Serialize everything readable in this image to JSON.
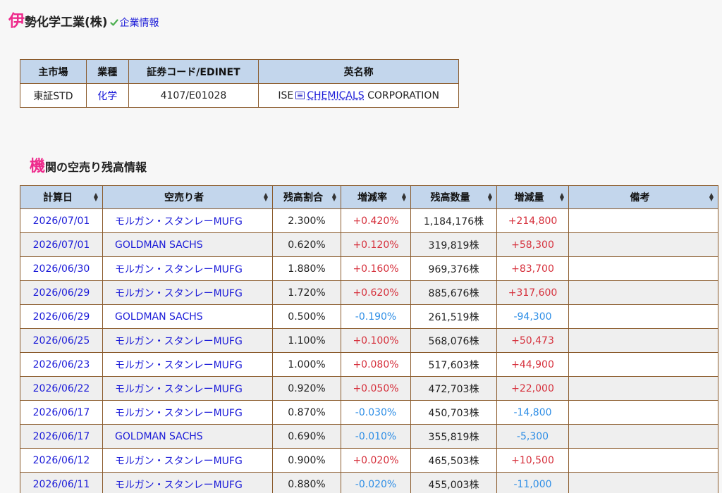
{
  "company": {
    "first_char": "伊",
    "rest": "勢化学工業(株)",
    "info_link": "企業情報"
  },
  "info_table": {
    "headers": [
      "主市場",
      "業種",
      "証券コード/EDINET",
      "英名称"
    ],
    "market": "東証STD",
    "industry": "化学",
    "code": "4107/E01028",
    "english_name_prefix": "ISE",
    "english_name_link": "CHEMICALS",
    "english_name_suffix": "CORPORATION"
  },
  "section": {
    "first_char": "機",
    "rest": "関の空売り残高情報"
  },
  "main_table": {
    "headers": [
      "計算日",
      "空売り者",
      "残高割合",
      "増減率",
      "残高数量",
      "増減量",
      "備考"
    ],
    "rows": [
      {
        "date": "2026/07/01",
        "seller": "モルガン・スタンレーMUFG",
        "ratio": "2.300%",
        "rate": "+0.420%",
        "qty": "1,184,176株",
        "change": "+214,800",
        "note": "",
        "sign": "pos"
      },
      {
        "date": "2026/07/01",
        "seller": "GOLDMAN SACHS",
        "ratio": "0.620%",
        "rate": "+0.120%",
        "qty": "319,819株",
        "change": "+58,300",
        "note": "",
        "sign": "pos"
      },
      {
        "date": "2026/06/30",
        "seller": "モルガン・スタンレーMUFG",
        "ratio": "1.880%",
        "rate": "+0.160%",
        "qty": "969,376株",
        "change": "+83,700",
        "note": "",
        "sign": "pos"
      },
      {
        "date": "2026/06/29",
        "seller": "モルガン・スタンレーMUFG",
        "ratio": "1.720%",
        "rate": "+0.620%",
        "qty": "885,676株",
        "change": "+317,600",
        "note": "",
        "sign": "pos"
      },
      {
        "date": "2026/06/29",
        "seller": "GOLDMAN SACHS",
        "ratio": "0.500%",
        "rate": "-0.190%",
        "qty": "261,519株",
        "change": "-94,300",
        "note": "",
        "sign": "neg"
      },
      {
        "date": "2026/06/25",
        "seller": "モルガン・スタンレーMUFG",
        "ratio": "1.100%",
        "rate": "+0.100%",
        "qty": "568,076株",
        "change": "+50,473",
        "note": "",
        "sign": "pos"
      },
      {
        "date": "2026/06/23",
        "seller": "モルガン・スタンレーMUFG",
        "ratio": "1.000%",
        "rate": "+0.080%",
        "qty": "517,603株",
        "change": "+44,900",
        "note": "",
        "sign": "pos"
      },
      {
        "date": "2026/06/22",
        "seller": "モルガン・スタンレーMUFG",
        "ratio": "0.920%",
        "rate": "+0.050%",
        "qty": "472,703株",
        "change": "+22,000",
        "note": "",
        "sign": "pos"
      },
      {
        "date": "2026/06/17",
        "seller": "モルガン・スタンレーMUFG",
        "ratio": "0.870%",
        "rate": "-0.030%",
        "qty": "450,703株",
        "change": "-14,800",
        "note": "",
        "sign": "neg"
      },
      {
        "date": "2026/06/17",
        "seller": "GOLDMAN SACHS",
        "ratio": "0.690%",
        "rate": "-0.010%",
        "qty": "355,819株",
        "change": "-5,300",
        "note": "",
        "sign": "neg"
      },
      {
        "date": "2026/06/12",
        "seller": "モルガン・スタンレーMUFG",
        "ratio": "0.900%",
        "rate": "+0.020%",
        "qty": "465,503株",
        "change": "+10,500",
        "note": "",
        "sign": "pos"
      },
      {
        "date": "2026/06/11",
        "seller": "モルガン・スタンレーMUFG",
        "ratio": "0.880%",
        "rate": "-0.020%",
        "qty": "455,003株",
        "change": "-11,000",
        "note": "",
        "sign": "neg"
      }
    ]
  },
  "colors": {
    "accent_pink": "#ee2a8c",
    "link_blue": "#1a1ad8",
    "positive_red": "#d6303c",
    "negative_blue": "#2e8ee6",
    "header_bg": "#c3d6ec",
    "border_brown": "#8a5a2b"
  },
  "icons": [
    "check-icon",
    "book-icon",
    "sort-icon"
  ]
}
